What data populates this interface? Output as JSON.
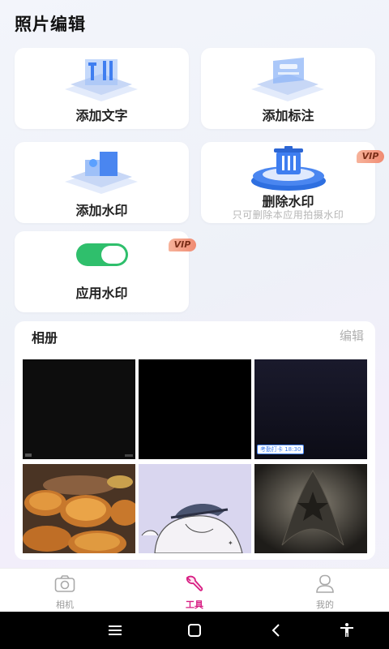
{
  "page": {
    "title": "照片编辑"
  },
  "tools": {
    "add_text": {
      "label": "添加文字"
    },
    "add_annotation": {
      "label": "添加标注"
    },
    "add_watermark": {
      "label": "添加水印"
    },
    "delete_watermark": {
      "label": "删除水印",
      "sublabel": "只可删除本应用拍摄水印",
      "badge": "VIP"
    },
    "apply_watermark": {
      "label": "应用水印",
      "badge": "VIP",
      "toggle_on": true
    }
  },
  "album": {
    "title": "相册",
    "edit_label": "编辑",
    "thumbnails": [
      {
        "kind": "dark-photo"
      },
      {
        "kind": "black"
      },
      {
        "kind": "dark-blue-photo",
        "stamp_text": "考勤打卡 18:30"
      },
      {
        "kind": "mooncakes"
      },
      {
        "kind": "sketch"
      },
      {
        "kind": "starfleet-logo"
      }
    ]
  },
  "tabbar": {
    "items": [
      {
        "label": "相机",
        "icon": "camera-icon",
        "active": false
      },
      {
        "label": "工具",
        "icon": "wrench-icon",
        "active": true
      },
      {
        "label": "我的",
        "icon": "profile-icon",
        "active": false
      }
    ]
  },
  "colors": {
    "accent": "#d81e83",
    "toggle_on": "#2fbf6c",
    "vip_badge": "#f08b72",
    "illustration_blue": "#4a86f0"
  }
}
